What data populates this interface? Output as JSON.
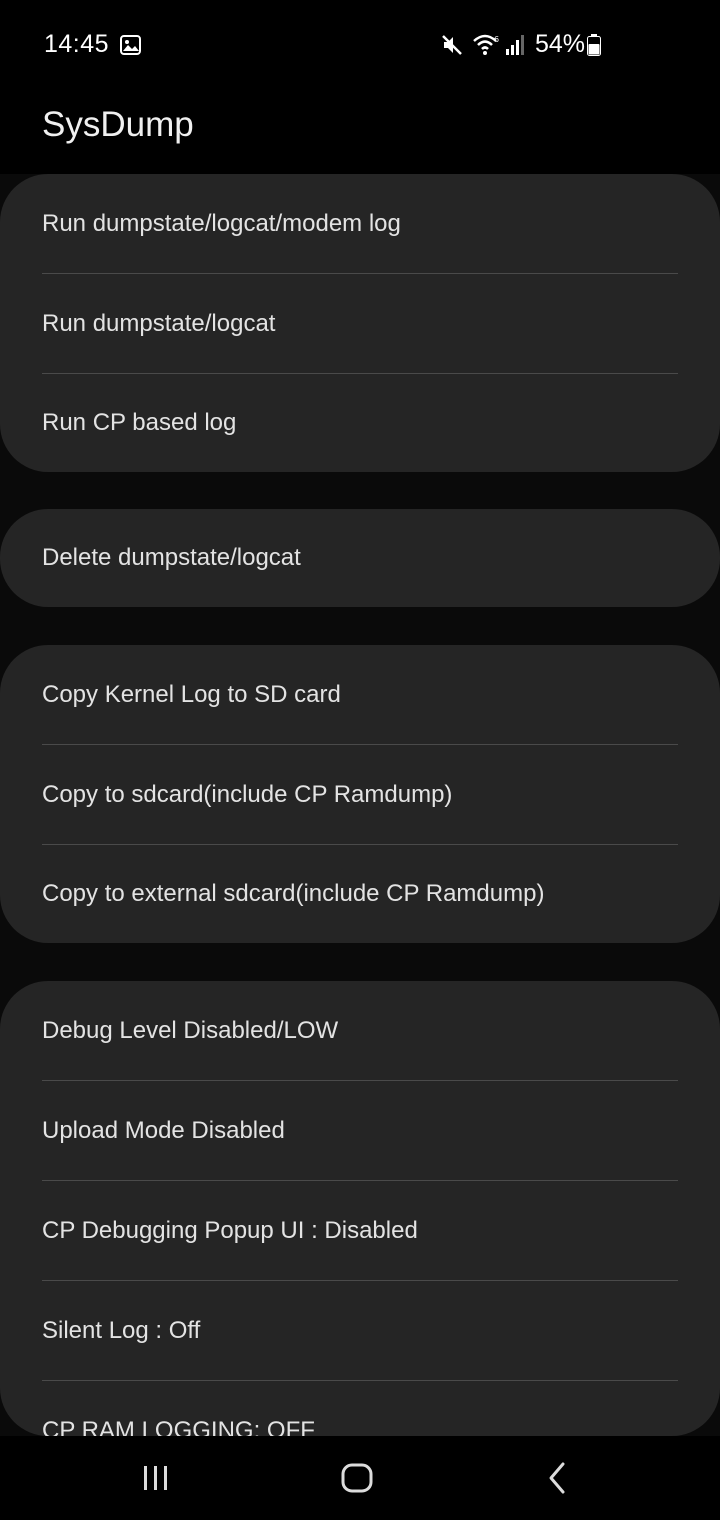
{
  "status_bar": {
    "time": "14:45",
    "battery_percent": "54%",
    "icons": [
      "image-icon",
      "mute-icon",
      "wifi-icon",
      "signal-icon",
      "battery-icon"
    ]
  },
  "app_bar": {
    "title": "SysDump"
  },
  "groups": [
    {
      "items": [
        {
          "label": "Run dumpstate/logcat/modem log"
        },
        {
          "label": "Run dumpstate/logcat"
        },
        {
          "label": "Run CP based log"
        }
      ]
    },
    {
      "items": [
        {
          "label": "Delete dumpstate/logcat"
        }
      ]
    },
    {
      "items": [
        {
          "label": "Copy Kernel Log to SD card"
        },
        {
          "label": "Copy to sdcard(include CP Ramdump)"
        },
        {
          "label": "Copy to external sdcard(include CP Ramdump)"
        }
      ]
    },
    {
      "items": [
        {
          "label": "Debug Level Disabled/LOW"
        },
        {
          "label": "Upload Mode Disabled"
        },
        {
          "label": "CP Debugging Popup UI : Disabled"
        },
        {
          "label": "Silent Log : Off"
        },
        {
          "label": "CP RAM LOGGING: OFF"
        }
      ]
    }
  ],
  "nav_bar": {
    "buttons": [
      "recents-icon",
      "home-icon",
      "back-icon"
    ]
  },
  "colors": {
    "background": "#0a0a0a",
    "card": "#252525",
    "text": "#e3e3e3",
    "divider": "#4a4a4a"
  }
}
